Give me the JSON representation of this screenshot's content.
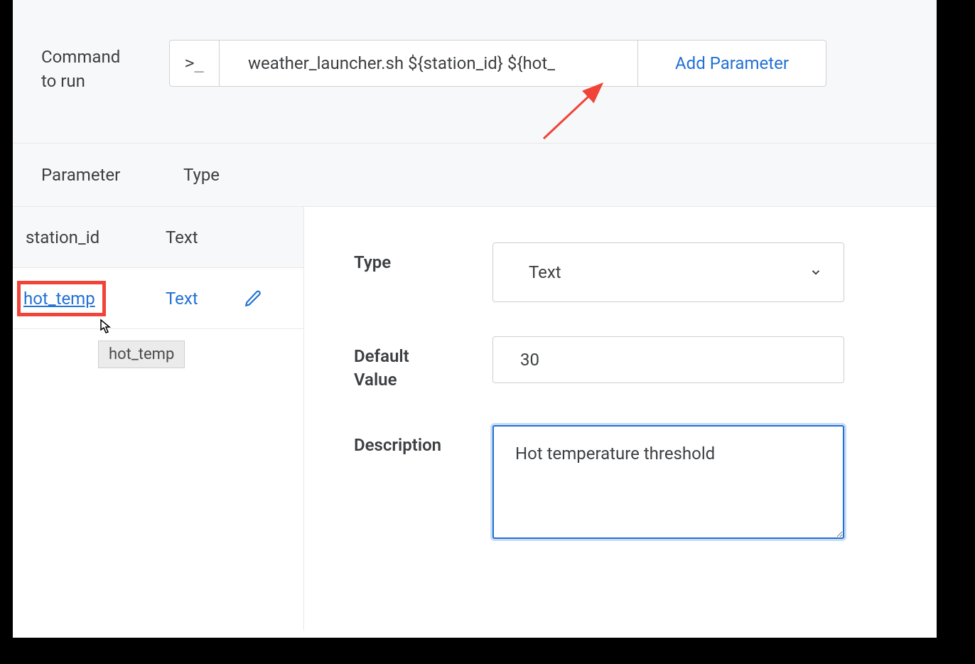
{
  "top": {
    "command_label_l1": "Command",
    "command_label_l2": "to run",
    "console_symbol": ">_",
    "command_value": "weather_launcher.sh ${station_id} ${hot_",
    "add_parameter_label": "Add Parameter"
  },
  "headers": {
    "parameter": "Parameter",
    "type": "Type"
  },
  "params": [
    {
      "name": "station_id",
      "type": "Text"
    },
    {
      "name": "hot_temp",
      "type": "Text"
    }
  ],
  "tooltip": "hot_temp",
  "detail": {
    "type_label": "Type",
    "type_value": "Text",
    "default_label_l1": "Default",
    "default_label_l2": "Value",
    "default_value": "30",
    "description_label": "Description",
    "description_value": "Hot temperature threshold"
  }
}
